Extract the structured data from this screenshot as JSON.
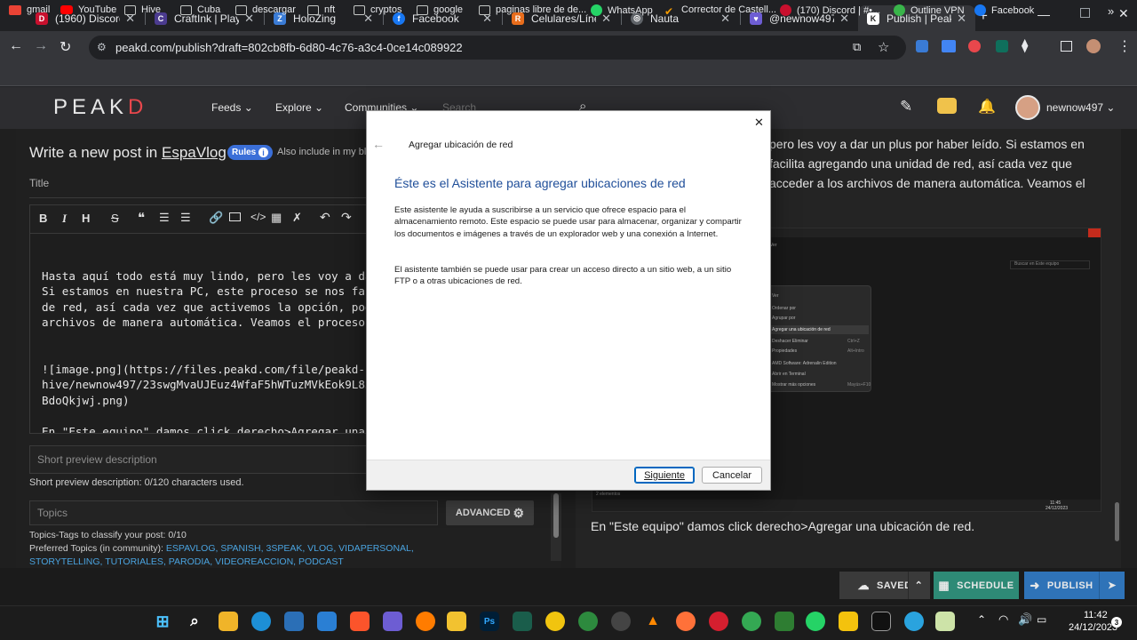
{
  "browser": {
    "tabs": [
      {
        "title": "(1960) Discord | ",
        "fav": "D",
        "color": "#c8102e"
      },
      {
        "title": "CraftInk | Play Ci",
        "fav": "C",
        "color": "#4b3b8f"
      },
      {
        "title": "HoloZing",
        "fav": "Z",
        "color": "#3a7bd5"
      },
      {
        "title": "Facebook",
        "fav": "f",
        "color": "#1877f2"
      },
      {
        "title": "Celulares/Líneas",
        "fav": "R",
        "color": "#e86d1c"
      },
      {
        "title": "Nauta",
        "fav": "◎",
        "color": "#5f6368"
      },
      {
        "title": "@newnow497 - ",
        "fav": "♥",
        "color": "#6d5dd3"
      },
      {
        "title": "Publish | PeakD",
        "fav": "K",
        "color": "#ffffff"
      }
    ],
    "url": "peakd.com/publish?draft=802cb8fb-6d80-4c76-a3c4-0ce14c089922",
    "bookmarks": [
      "gmail",
      "YouTube",
      "Hive",
      "Cuba",
      "descargar",
      "nft",
      "cryptos",
      "google",
      "paginas libre de de...",
      "WhatsApp",
      "Corrector de Castell...",
      "(170) Discord | #•...",
      "Outline VPN",
      "Facebook"
    ]
  },
  "peakd": {
    "logo_left": "PEAK",
    "logo_right": "D",
    "nav": [
      "Feeds",
      "Explore",
      "Communities"
    ],
    "search_placeholder": "Search",
    "username": "newnow497"
  },
  "editor": {
    "heading": "Write a new post in",
    "community": "EspaVlog",
    "rules_label": "Rules",
    "also_include": "Also include in my blog",
    "title_placeholder": "Title",
    "body_lines": [
      "Hasta aquí todo está muy lindo, pero les voy a dar u",
      "Si estamos en nuestra PC, este proceso se nos facil",
      "de red, así cada vez que activemos la opción, podrem",
      "archivos de manera automática. Veamos el proceso.",
      "",
      "",
      "![image.png](https://files.peakd.com/file/peakd-",
      "hive/newnow497/23swgMvaUJEuz4WfaF5hWTuzMVkEok9L83eQK",
      "BdoQkjwj.png)",
      "",
      "En \"Este equipo\" damos click derecho>Agregar una ubi"
    ],
    "short_preview_placeholder": "Short preview description",
    "short_preview_count": "Short preview description: 0/120 characters used.",
    "topics_placeholder": "Topics",
    "advanced_label": "ADVANCED",
    "topics_count": "Topics-Tags to classify your post: 0/10",
    "preferred_label": "Preferred Topics (in community):",
    "preferred_topics": "ESPAVLOG, SPANISH, 3SPEAK, VLOG, VIDAPERSONAL,",
    "preferred_topics_2": "STORYTELLING, TUTORIALES, PARODIA, VIDEOREACCION, PODCAST"
  },
  "preview": {
    "line1": "pero les voy a dar un plus por haber leído. Si estamos en",
    "line2": "facilita agregando una unidad de red, así cada vez que",
    "line3": "acceder a los archivos de manera automática. Veamos el",
    "caption": "En \"Este equipo\" damos click derecho>Agregar una ubicación de red.",
    "shot_menu": [
      "Ver",
      "Ordenar por",
      "Agrupar por",
      "Agregar una ubicación de red",
      "Deshacer Eliminar",
      "Propiedades",
      "AMD Software: Adrenalin Edition",
      "Abrir en Terminal",
      "Mostrar más opciones"
    ],
    "shot_shortcuts": [
      "",
      "",
      "",
      "",
      "Ctrl+Z",
      "Alt+Intro",
      "",
      "",
      "Mayús+F10"
    ],
    "shot_search": "Buscar en Este equipo",
    "shot_status": "2 elementos",
    "shot_time": "11:45",
    "shot_date": "24/12/2023"
  },
  "footer": {
    "saved": "SAVED",
    "schedule": "SCHEDULE",
    "publish": "PUBLISH"
  },
  "dialog": {
    "window_title": "Agregar ubicación de red",
    "heading": "Éste es el Asistente para agregar ubicaciones de red",
    "para1": "Este asistente le ayuda a suscribirse a un servicio que ofrece espacio para el almacenamiento remoto. Este espacio se puede usar para almacenar, organizar y compartir los documentos e imágenes a través de un explorador web y una conexión a Internet.",
    "para2": "El asistente también se puede usar para crear un acceso directo a un sitio web, a un sitio FTP o a otras ubicaciones de red.",
    "next": "Siguiente",
    "cancel": "Cancelar",
    "accent": "#1f4e99"
  },
  "taskbar": {
    "time": "11:42",
    "date": "24/12/2023",
    "notif": "3",
    "apps": [
      "Ps",
      "Ai"
    ]
  }
}
